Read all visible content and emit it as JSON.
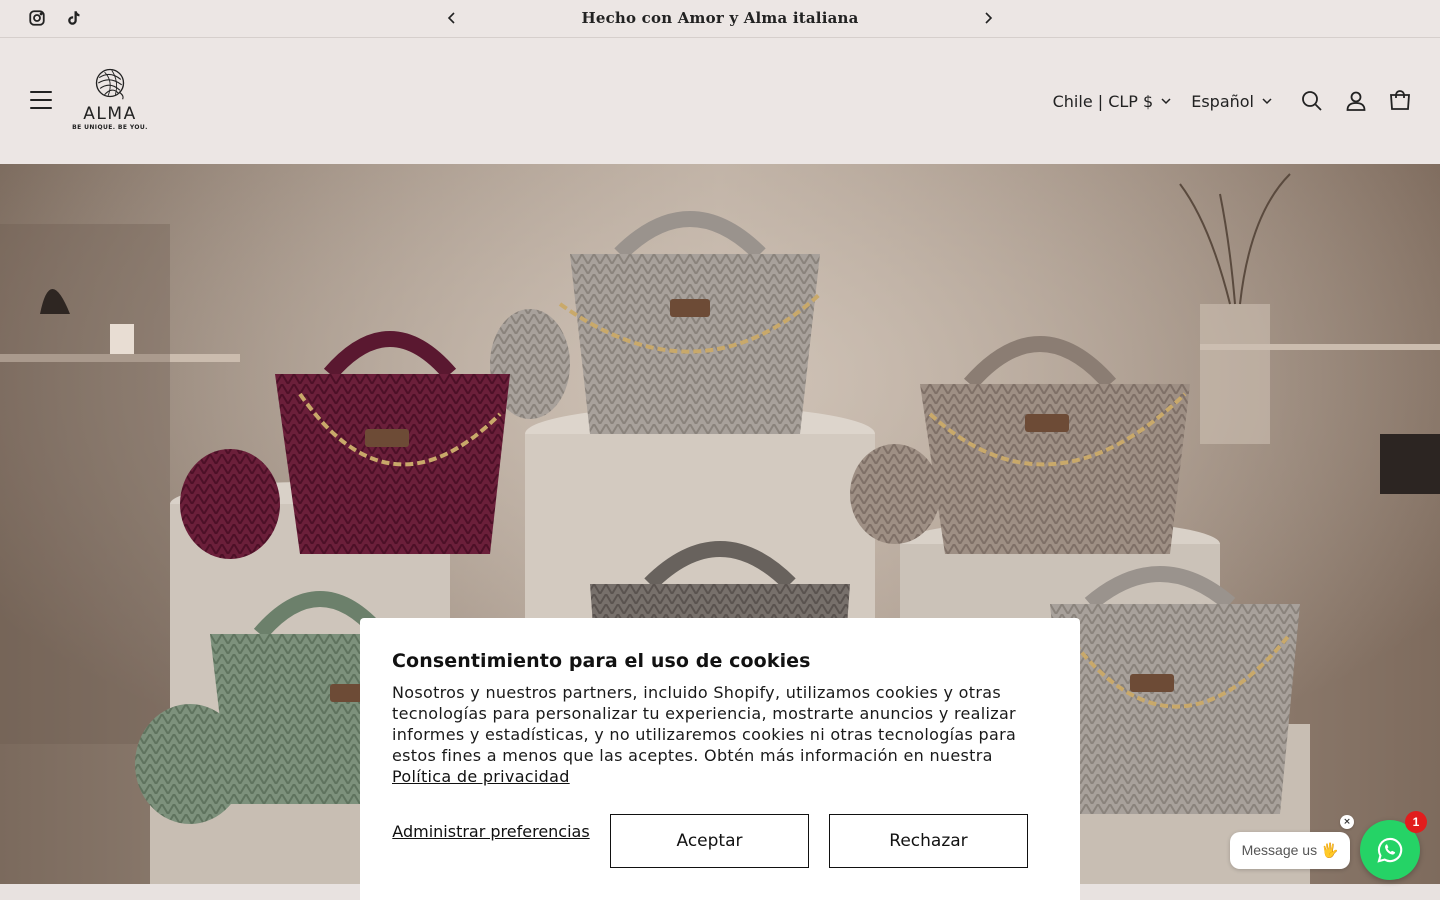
{
  "announcement": {
    "text": "Hecho con Amor y Alma italiana",
    "prev_icon": "chevron-left-icon",
    "next_icon": "chevron-right-icon"
  },
  "social": [
    {
      "name": "instagram",
      "icon": "instagram-icon"
    },
    {
      "name": "tiktok",
      "icon": "tiktok-icon"
    }
  ],
  "header": {
    "logo_text": "ALMA",
    "logo_tagline": "BE UNIQUE. BE YOU.",
    "country_selector": "Chile | CLP $",
    "language_selector": "Español",
    "icons": [
      "menu-icon",
      "search-icon",
      "account-icon",
      "cart-icon"
    ]
  },
  "hero": {
    "background_color": "#8a7666",
    "accent_color": "#6b1f3a"
  },
  "cookie_banner": {
    "title": "Consentimiento para el uso de cookies",
    "body": "Nosotros y nuestros partners, incluido Shopify, utilizamos cookies y otras tecnologías para personalizar tu experiencia, mostrarte anuncios y realizar informes y estadísticas, y no utilizaremos cookies ni otras tecnologías para estos fines a menos que las aceptes. Obtén más información en nuestra",
    "privacy_link": "Política de privacidad",
    "manage_label": "Administrar preferencias",
    "accept_label": "Aceptar",
    "reject_label": "Rechazar"
  },
  "chat": {
    "message": "Message us 🖐",
    "badge_count": "1",
    "close_label": "×",
    "brand_color": "#25d366"
  }
}
